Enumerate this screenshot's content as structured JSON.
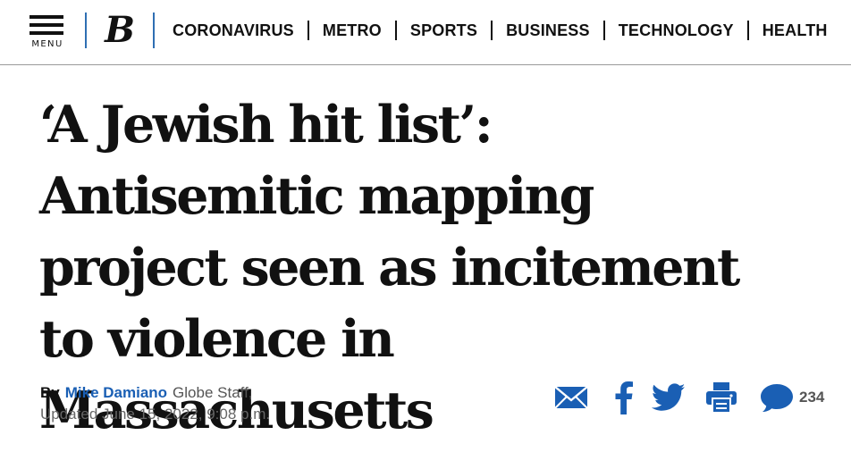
{
  "header": {
    "menu_label": "MENU",
    "logo_letter": "B",
    "nav": [
      {
        "label": "CORONAVIRUS"
      },
      {
        "label": "METRO"
      },
      {
        "label": "SPORTS"
      },
      {
        "label": "BUSINESS"
      },
      {
        "label": "TECHNOLOGY"
      },
      {
        "label": "HEALTH"
      }
    ]
  },
  "article": {
    "headline": "‘A Jewish hit list’: Antisemitic mapping project seen as incitement to violence in Massachusetts",
    "byline": {
      "by": "By",
      "author": "Mike Damiano",
      "role": "Globe Staff,",
      "updated": "Updated June 15, 2022, 9:08 p.m."
    }
  },
  "share": {
    "icons": [
      "email-icon",
      "facebook-icon",
      "twitter-icon",
      "print-icon",
      "comment-icon"
    ],
    "comment_count": "234",
    "accent_color": "#1a5fb4"
  }
}
